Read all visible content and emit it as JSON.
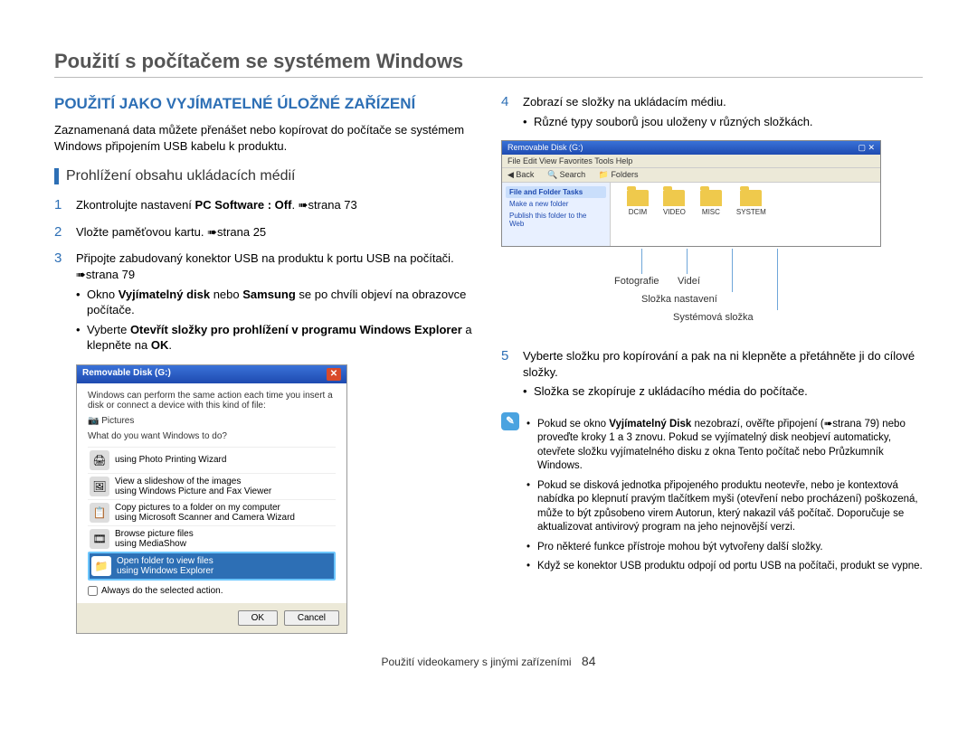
{
  "page_title": "Použití s počítačem se systémem Windows",
  "section_title": "POUŽITÍ JAKO VYJÍMATELNÉ ÚLOŽNÉ ZAŘÍZENÍ",
  "intro": "Zaznamenaná data můžete přenášet nebo kopírovat do počítače se systémem Windows připojením USB kabelu k produktu.",
  "subheading": "Prohlížení obsahu ukládacích médií",
  "steps": {
    "s1": {
      "num": "1",
      "pre": "Zkontrolujte nastavení ",
      "bold": "PC Software : Off",
      "post": ". ➠strana 73"
    },
    "s2": {
      "num": "2",
      "text": "Vložte paměťovou kartu. ➠strana 25"
    },
    "s3": {
      "num": "3",
      "text": "Připojte zabudovaný konektor USB na produktu k portu USB na počítači. ➠strana 79",
      "b1_pre": "Okno ",
      "b1_bold": "Vyjímatelný disk",
      "b1_mid": " nebo ",
      "b1_bold2": "Samsung",
      "b1_post": " se po chvíli objeví na obrazovce počítače.",
      "b2_pre": "Vyberte ",
      "b2_bold": "Otevřít složky pro prohlížení v programu Windows Explorer",
      "b2_mid": " a klepněte na ",
      "b2_bold2": "OK",
      "b2_post": "."
    },
    "s4": {
      "num": "4",
      "text": "Zobrazí se složky na ukládacím médiu.",
      "b1": "Různé typy souborů jsou uloženy v různých složkách."
    },
    "s5": {
      "num": "5",
      "text": "Vyberte složku pro kopírování a pak na ni klepněte a přetáhněte ji do cílové složky.",
      "b1": "Složka se zkopíruje z ukládacího média do počítače."
    }
  },
  "dialog": {
    "title": "Removable Disk (G:)",
    "line1": "Windows can perform the same action each time you insert a disk or connect a device with this kind of file:",
    "pictures": "Pictures",
    "prompt": "What do you want Windows to do?",
    "opt1": {
      "t": "using Photo Printing Wizard"
    },
    "opt2": {
      "t": "View a slideshow of the images",
      "s": "using Windows Picture and Fax Viewer"
    },
    "opt3": {
      "t": "Copy pictures to a folder on my computer",
      "s": "using Microsoft Scanner and Camera Wizard"
    },
    "opt4": {
      "t": "Browse picture files",
      "s": "using MediaShow"
    },
    "opt5": {
      "t": "Open folder to view files",
      "s": "using Windows Explorer"
    },
    "always": "Always do the selected action.",
    "ok": "OK",
    "cancel": "Cancel"
  },
  "explorer": {
    "title": "Removable Disk (G:)",
    "menu": "File   Edit   View   Favorites   Tools   Help",
    "back": "Back",
    "search": "Search",
    "folders": "Folders",
    "task": "File and Folder Tasks",
    "link1": "Make a new folder",
    "link2": "Publish this folder to the Web",
    "f1": "DCIM",
    "f2": "VIDEO",
    "f3": "MISC",
    "f4": "SYSTEM"
  },
  "labels": {
    "foto": "Fotografie",
    "vid": "Videí",
    "nast": "Složka nastavení",
    "sys": "Systémová složka"
  },
  "notes": {
    "n1_pre": "Pokud se okno ",
    "n1_bold": "Vyjímatelný Disk",
    "n1_post": " nezobrazí, ověřte připojení (➠strana 79) nebo proveďte kroky 1 a 3 znovu. Pokud se vyjímatelný disk neobjeví automaticky, otevřete složku vyjímatelného disku z okna Tento počítač nebo Průzkumník Windows.",
    "n2": "Pokud se disková jednotka připojeného produktu neotevře, nebo je kontextová nabídka po klepnutí pravým tlačítkem myši (otevření nebo procházení) poškozená, může to být způsobeno virem Autorun, který nakazil váš počítač. Doporučuje se aktualizovat antivirový program na jeho nejnovější verzi.",
    "n3": "Pro některé funkce přístroje mohou být vytvořeny další složky.",
    "n4": "Když se konektor USB produktu odpojí od portu USB na počítači, produkt se vypne."
  },
  "footer": {
    "text": "Použití videokamery s jinými zařízeními",
    "page": "84"
  }
}
